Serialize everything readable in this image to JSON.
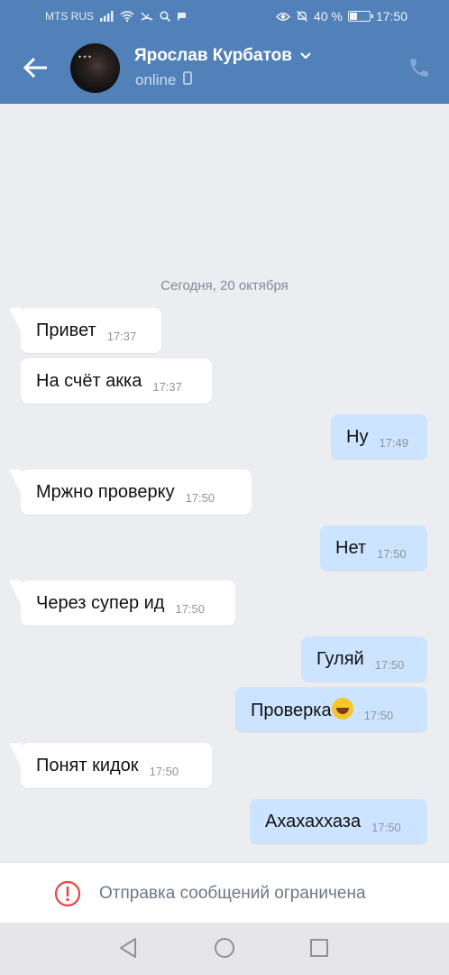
{
  "status_bar": {
    "carrier": "MTS RUS",
    "battery_percent": "40 %",
    "battery_level": 0.4,
    "time": "17:50"
  },
  "header": {
    "contact_name": "Ярослав Курбатов",
    "contact_status": "online",
    "icons": [
      "back-arrow-icon",
      "chevron-down-icon",
      "mobile-device-icon",
      "phone-icon"
    ]
  },
  "chat": {
    "date_separator": "Сегодня, 20 октября",
    "messages": [
      {
        "direction": "in",
        "text": "Привет",
        "time": "17:37"
      },
      {
        "direction": "in",
        "text": "На счёт акка",
        "time": "17:37"
      },
      {
        "direction": "out",
        "text": "Ну",
        "time": "17:49"
      },
      {
        "direction": "in",
        "text": "Мржно проверку",
        "time": "17:50"
      },
      {
        "direction": "out",
        "text": "Нет",
        "time": "17:50"
      },
      {
        "direction": "in",
        "text": "Через супер ид",
        "time": "17:50"
      },
      {
        "direction": "out",
        "text": "Гуляй",
        "time": "17:50"
      },
      {
        "direction": "out",
        "text": "Проверка",
        "emoji": "rolling-on-floor-laughing-emoji",
        "time": "17:50"
      },
      {
        "direction": "in",
        "text": "Понят кидок",
        "time": "17:50"
      },
      {
        "direction": "out",
        "text": "Ахахаххаза",
        "time": "17:50"
      }
    ]
  },
  "footer": {
    "restriction_text": "Отправка сообщений ограничена"
  },
  "colors": {
    "header_bg": "#5181b8",
    "chat_bg": "#ebedf0",
    "incoming_bubble": "#ffffff",
    "outgoing_bubble": "#cce4ff",
    "alert_red": "#e64646"
  }
}
